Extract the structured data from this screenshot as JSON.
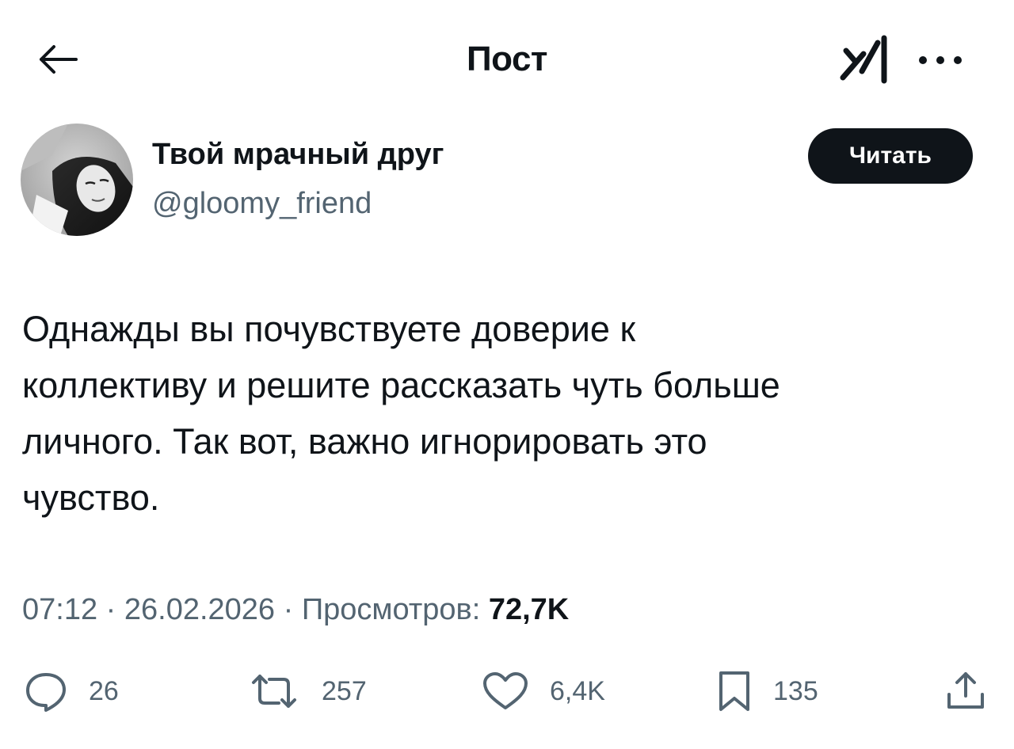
{
  "header": {
    "title": "Пост",
    "back_icon": "arrow-left-icon",
    "logo_icon": "grok-logo-icon",
    "more_icon": "more-horizontal-icon"
  },
  "author": {
    "name": "Твой мрачный друг",
    "handle": "@gloomy_friend",
    "follow_label": "Читать"
  },
  "post": {
    "lines": [
      "Однажды вы почувствуете доверие к",
      "коллективу и решите рассказать чуть больше",
      "личного. Так вот, важно игнорировать это",
      "чувство."
    ]
  },
  "meta": {
    "time": "07:12",
    "separator": "·",
    "date": "26.02.2026",
    "views_label": "Просмотров:",
    "views_count": "72,7K"
  },
  "actions": {
    "replies": "26",
    "reposts": "257",
    "likes": "6,4K",
    "bookmarks": "135"
  },
  "colors": {
    "text": "#0f1419",
    "secondary": "#536471",
    "button_bg": "#0f1419"
  }
}
